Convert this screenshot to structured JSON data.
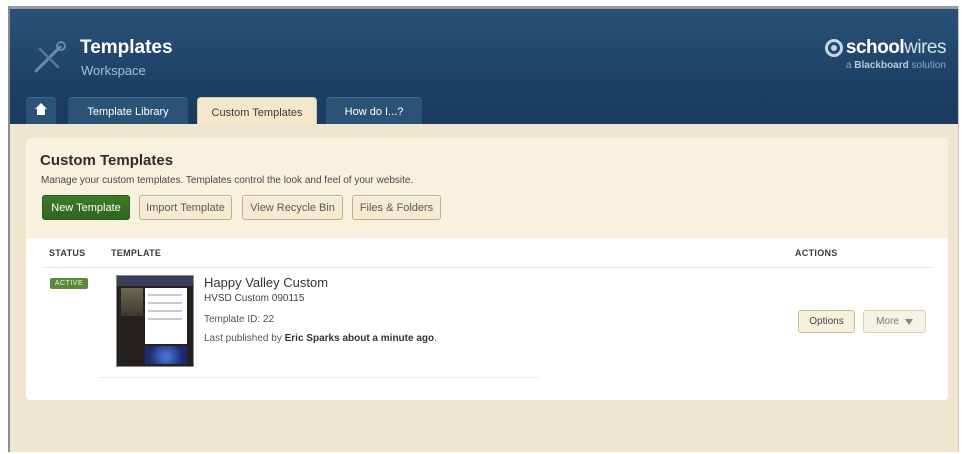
{
  "header": {
    "title": "Templates",
    "subtitle": "Workspace",
    "brand": {
      "name_light": "school",
      "name_bold": "wires",
      "tagline_prefix": "a ",
      "tagline_bold": "Blackboard",
      "tagline_suffix": " solution"
    }
  },
  "tabs": [
    {
      "label": "",
      "icon": "home-icon"
    },
    {
      "label": "Template Library"
    },
    {
      "label": "Custom Templates",
      "active": true
    },
    {
      "label": "How do I...?"
    }
  ],
  "panel": {
    "title": "Custom Templates",
    "description": "Manage your custom templates. Templates control the look and feel of your website.",
    "buttons": {
      "new_template": "New Template",
      "import_template": "Import Template",
      "recycle_bin": "View Recycle Bin",
      "files_folders": "Files & Folders"
    }
  },
  "table": {
    "columns": {
      "status": "STATUS",
      "template": "TEMPLATE",
      "actions": "ACTIONS"
    },
    "rows": [
      {
        "status": "ACTIVE",
        "name": "Happy Valley Custom",
        "code": "HVSD Custom 090115",
        "template_id": "Template ID: 22",
        "published_prefix": "Last published by ",
        "published_by": "Eric Sparks about a minute ago",
        "published_suffix": ".",
        "actions": {
          "options": "Options",
          "more": "More"
        }
      }
    ]
  },
  "colors": {
    "header_bg": "#1e4168",
    "workspace_bg": "#efe6cf",
    "primary_button": "#3a7225",
    "active_badge": "#5c8a3c"
  }
}
